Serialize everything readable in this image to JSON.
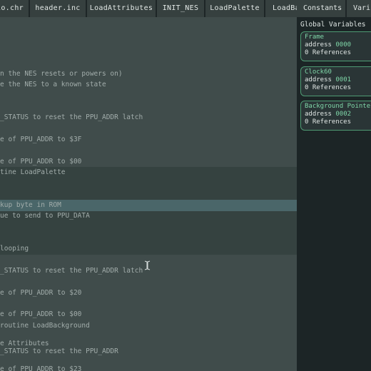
{
  "tabs": [
    {
      "label": "io.chr"
    },
    {
      "label": "header.inc"
    },
    {
      "label": "LoadAttributes"
    },
    {
      "label": "INIT_NES"
    },
    {
      "label": "LoadPalette"
    },
    {
      "label": "LoadBa"
    }
  ],
  "right_tabs": [
    {
      "label": "Constants"
    },
    {
      "label": "Vari"
    }
  ],
  "editor": {
    "lines": [
      {
        "text": "",
        "y": 0
      },
      {
        "text": "n the NES resets or powers on)",
        "y": 0
      },
      {
        "text": "e the NES to a known state",
        "y": 0
      },
      {
        "text": "_STATUS to reset the PPU_ADDR latch",
        "y": 0
      },
      {
        "text": "e of PPU_ADDR to $3F",
        "y": 0
      },
      {
        "text": "e of PPU_ADDR to $00",
        "y": 0
      },
      {
        "text": "tine LoadPalette",
        "y": 0
      },
      {
        "text": "kup byte in ROM",
        "y": 0
      },
      {
        "text": "ue to send to PPU_DATA",
        "y": 0
      },
      {
        "text": "looping",
        "y": 0
      },
      {
        "text": "_STATUS to reset the PPU_ADDR latch",
        "y": 0
      },
      {
        "text": "e of PPU_ADDR to $20",
        "y": 0
      },
      {
        "text": "e of PPU_ADDR to $00",
        "y": 0
      },
      {
        "text": "routine LoadBackground",
        "y": 0
      },
      {
        "text": "e Attributes",
        "y": 0
      },
      {
        "text": "_STATUS to reset the PPU_ADDR",
        "y": 0
      },
      {
        "text": "e of PPU_ADDR to $23",
        "y": 0
      }
    ]
  },
  "sidebar": {
    "title": "Global Variables",
    "address_label": "address",
    "variables": [
      {
        "name": "Frame",
        "address": "0000",
        "refs": "0 References"
      },
      {
        "name": "Clock60",
        "address": "0001",
        "refs": "0 References"
      },
      {
        "name": "Background Pointer",
        "address": "0002",
        "refs": "0 References"
      }
    ]
  },
  "colors": {
    "accent": "#7fd6a8",
    "editor_bg": "#404c4b",
    "highlight": "#4a6669"
  },
  "icons": {
    "cursor": "text-cursor-icon"
  }
}
